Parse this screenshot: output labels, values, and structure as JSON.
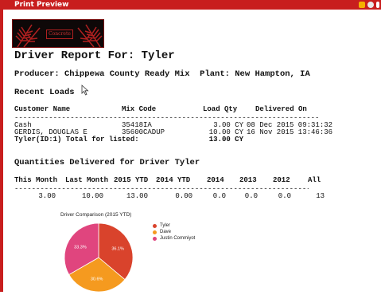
{
  "window": {
    "title": "Print Preview"
  },
  "logo": {
    "text": "Concrete"
  },
  "report": {
    "title": "Driver Report For: Tyler",
    "producer_line": "Producer: Chippewa County Ready Mix  Plant: New Hampton, IA",
    "recent_loads_heading": "Recent Loads",
    "loads_table": {
      "headers": [
        "Customer Name",
        "Mix Code",
        "Load Qty",
        "Delivered On"
      ],
      "separator": "-----------------------------------------------------------------------",
      "rows": [
        [
          "Cash",
          "35418IA",
          "3.00 CY",
          "08 Dec 2015 09:31:32"
        ],
        [
          "GERDIS, DOUGLAS E",
          "35600CADUP",
          "10.00 CY",
          "16 Nov 2015 13:46:36"
        ]
      ],
      "total_label": "Tyler(ID:1) Total for listed:",
      "total_value": "13.00 CY"
    },
    "quantities_heading": "Quantities Delivered for Driver Tyler",
    "quantities_table": {
      "headers": [
        "This Month",
        "Last Month",
        "2015 YTD",
        "2014 YTD",
        "2014",
        "2013",
        "2012",
        "All"
      ],
      "separator": "-----------------------------------------------------------------------",
      "values": [
        "3.00",
        "10.00",
        "13.00",
        "0.00",
        "0.0",
        "0.0",
        "0.0",
        "13"
      ]
    }
  },
  "chart_data": {
    "type": "pie",
    "title": "Driver Comparison (2015 YTD)",
    "labels": [
      "Tyler",
      "Dave",
      "Justin Commiyot"
    ],
    "values": [
      36.1,
      30.6,
      33.3
    ],
    "value_labels": [
      "36.1%",
      "30.6%",
      "33.3%"
    ],
    "colors": [
      "#d9432c",
      "#f59a1f",
      "#e0457e"
    ]
  }
}
